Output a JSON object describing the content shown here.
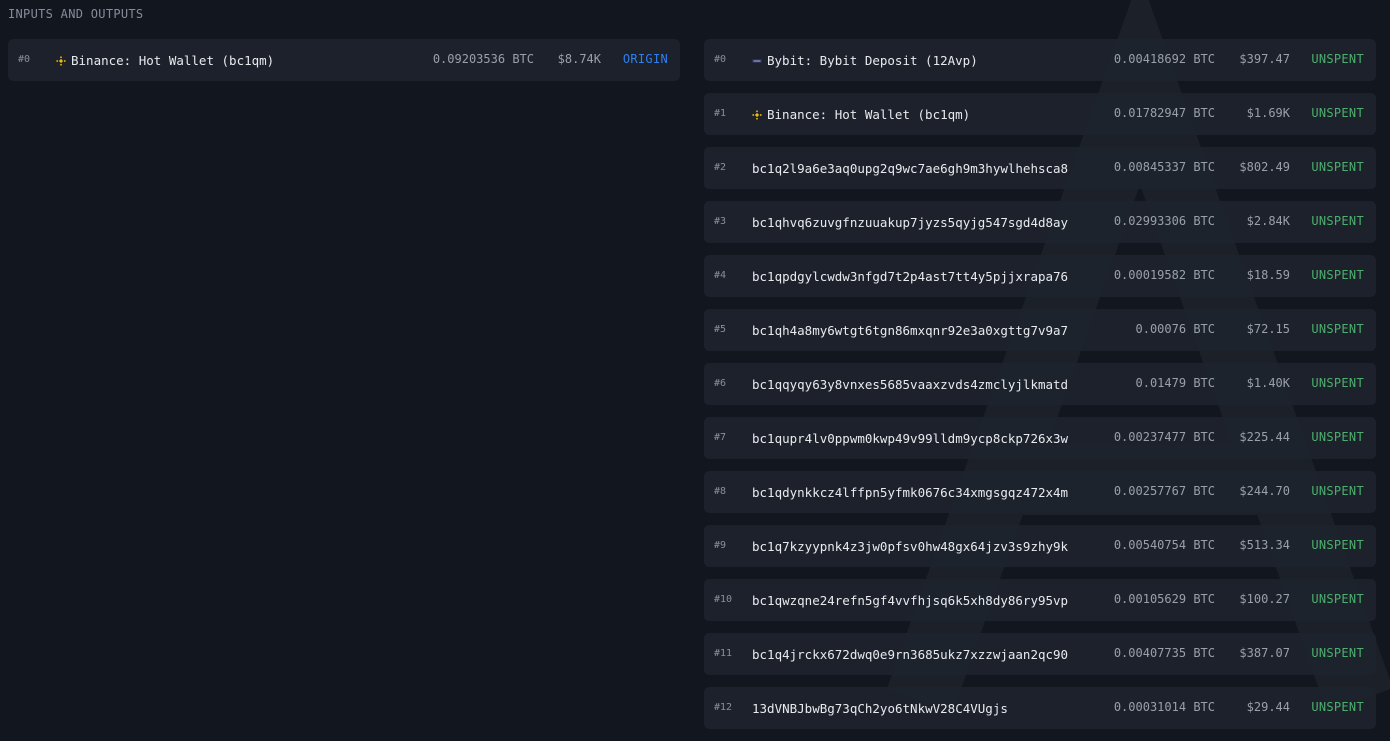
{
  "section_title": "INPUTS AND OUTPUTS",
  "colors": {
    "origin": "#2f80ed",
    "unspent": "#4caf6d",
    "binance": "#f0b90b",
    "bybit": "#8a8fd6"
  },
  "inputs": [
    {
      "index": "#0",
      "icon": "binance-icon",
      "label": "Binance: Hot Wallet (bc1qm)",
      "amount": "0.09203536",
      "unit": "BTC",
      "usd": "$8.74K",
      "status": "ORIGIN"
    }
  ],
  "outputs": [
    {
      "index": "#0",
      "icon": "bybit-icon",
      "label": "Bybit: Bybit Deposit (12Avp)",
      "amount": "0.00418692",
      "unit": "BTC",
      "usd": "$397.47",
      "status": "UNSPENT"
    },
    {
      "index": "#1",
      "icon": "binance-icon",
      "label": "Binance: Hot Wallet (bc1qm)",
      "amount": "0.01782947",
      "unit": "BTC",
      "usd": "$1.69K",
      "status": "UNSPENT"
    },
    {
      "index": "#2",
      "icon": "",
      "label": "bc1q2l9a6e3aq0upg2q9wc7ae6gh9m3hywlhehsca8",
      "amount": "0.00845337",
      "unit": "BTC",
      "usd": "$802.49",
      "status": "UNSPENT"
    },
    {
      "index": "#3",
      "icon": "",
      "label": "bc1qhvq6zuvgfnzuuakup7jyzs5qyjg547sgd4d8ay",
      "amount": "0.02993306",
      "unit": "BTC",
      "usd": "$2.84K",
      "status": "UNSPENT"
    },
    {
      "index": "#4",
      "icon": "",
      "label": "bc1qpdgylcwdw3nfgd7t2p4ast7tt4y5pjjxrapa76",
      "amount": "0.00019582",
      "unit": "BTC",
      "usd": "$18.59",
      "status": "UNSPENT"
    },
    {
      "index": "#5",
      "icon": "",
      "label": "bc1qh4a8my6wtgt6tgn86mxqnr92e3a0xgttg7v9a7",
      "amount": "0.00076",
      "unit": "BTC",
      "usd": "$72.15",
      "status": "UNSPENT"
    },
    {
      "index": "#6",
      "icon": "",
      "label": "bc1qqyqy63y8vnxes5685vaaxzvds4zmclyjlkmatd",
      "amount": "0.01479",
      "unit": "BTC",
      "usd": "$1.40K",
      "status": "UNSPENT"
    },
    {
      "index": "#7",
      "icon": "",
      "label": "bc1qupr4lv0ppwm0kwp49v99lldm9ycp8ckp726x3w",
      "amount": "0.00237477",
      "unit": "BTC",
      "usd": "$225.44",
      "status": "UNSPENT"
    },
    {
      "index": "#8",
      "icon": "",
      "label": "bc1qdynkkcz4lffpn5yfmk0676c34xmgsgqz472x4m",
      "amount": "0.00257767",
      "unit": "BTC",
      "usd": "$244.70",
      "status": "UNSPENT"
    },
    {
      "index": "#9",
      "icon": "",
      "label": "bc1q7kzyypnk4z3jw0pfsv0hw48gx64jzv3s9zhy9k",
      "amount": "0.00540754",
      "unit": "BTC",
      "usd": "$513.34",
      "status": "UNSPENT"
    },
    {
      "index": "#10",
      "icon": "",
      "label": "bc1qwzqne24refn5gf4vvfhjsq6k5xh8dy86ry95vp",
      "amount": "0.00105629",
      "unit": "BTC",
      "usd": "$100.27",
      "status": "UNSPENT"
    },
    {
      "index": "#11",
      "icon": "",
      "label": "bc1q4jrckx672dwq0e9rn3685ukz7xzzwjaan2qc90",
      "amount": "0.00407735",
      "unit": "BTC",
      "usd": "$387.07",
      "status": "UNSPENT"
    },
    {
      "index": "#12",
      "icon": "",
      "label": "13dVNBJbwBg73qCh2yo6tNkwV28C4VUgjs",
      "amount": "0.00031014",
      "unit": "BTC",
      "usd": "$29.44",
      "status": "UNSPENT"
    }
  ]
}
